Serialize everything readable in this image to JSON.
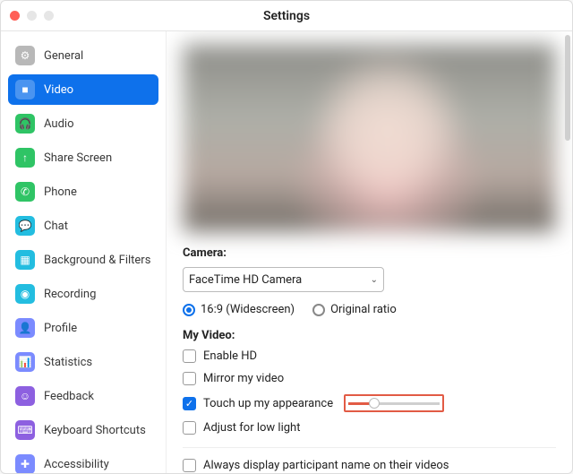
{
  "window": {
    "title": "Settings"
  },
  "sidebar": {
    "items": [
      {
        "label": "General",
        "icon_bg": "#b8b8b8",
        "glyph": "⚙"
      },
      {
        "label": "Video",
        "icon_bg": "#0e71eb",
        "glyph": "■"
      },
      {
        "label": "Audio",
        "icon_bg": "#2fc465",
        "glyph": "🎧"
      },
      {
        "label": "Share Screen",
        "icon_bg": "#2fc465",
        "glyph": "↑"
      },
      {
        "label": "Phone",
        "icon_bg": "#2fc465",
        "glyph": "✆"
      },
      {
        "label": "Chat",
        "icon_bg": "#23bde0",
        "glyph": "💬"
      },
      {
        "label": "Background & Filters",
        "icon_bg": "#23bde0",
        "glyph": "▦"
      },
      {
        "label": "Recording",
        "icon_bg": "#23bde0",
        "glyph": "◉"
      },
      {
        "label": "Profile",
        "icon_bg": "#7b8bff",
        "glyph": "👤"
      },
      {
        "label": "Statistics",
        "icon_bg": "#7b8bff",
        "glyph": "📊"
      },
      {
        "label": "Feedback",
        "icon_bg": "#8d60e0",
        "glyph": "☺"
      },
      {
        "label": "Keyboard Shortcuts",
        "icon_bg": "#8d60e0",
        "glyph": "⌨"
      },
      {
        "label": "Accessibility",
        "icon_bg": "#7b8bff",
        "glyph": "✚"
      }
    ],
    "active_index": 1
  },
  "video": {
    "camera_label": "Camera:",
    "camera_selected": "FaceTime HD Camera",
    "ratio_16_9": "16:9 (Widescreen)",
    "ratio_original": "Original ratio",
    "my_video_label": "My Video:",
    "enable_hd": "Enable HD",
    "mirror": "Mirror my video",
    "touch_up": "Touch up my appearance",
    "low_light": "Adjust for low light",
    "always_name": "Always display participant name on their videos"
  }
}
